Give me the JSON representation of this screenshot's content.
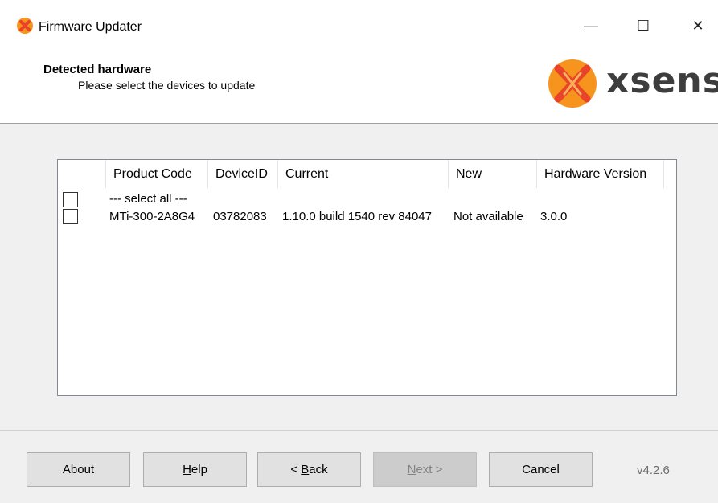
{
  "window": {
    "title": "Firmware Updater",
    "minimize_glyph": "—",
    "maximize_glyph": "☐",
    "close_glyph": "✕"
  },
  "header": {
    "title": "Detected hardware",
    "subtitle": "Please select the devices to update",
    "logo_text": "xsens"
  },
  "device_list": {
    "columns": [
      "Product Code",
      "DeviceID",
      "Current",
      "New",
      "Hardware Version"
    ],
    "select_all_label": "--- select all ---",
    "rows": [
      {
        "checked": false,
        "product_code": "MTi-300-2A8G4",
        "device_id": "03782083",
        "current": "1.10.0 build 1540 rev 84047",
        "new": "Not available",
        "hardware_version": "3.0.0"
      }
    ]
  },
  "footer": {
    "about_label": "About",
    "help_label": "Help",
    "help_mnemonic": "H",
    "help_rest": "elp",
    "back_prefix": "< ",
    "back_mnemonic": "B",
    "back_rest": "ack",
    "next_mnemonic": "N",
    "next_rest": "ext >",
    "cancel_label": "Cancel",
    "version": "v4.2.6"
  },
  "colors": {
    "brand_orange": "#f7941d",
    "brand_red": "#e8442a",
    "logo_text": "#3d3d3d",
    "panel_bg": "#f0f0f0",
    "button_bg": "#e1e1e1",
    "button_disabled_bg": "#cccccc"
  },
  "icons": {
    "app_icon": "xsens-app-icon",
    "logo_mark": "xsens-logo-mark"
  }
}
